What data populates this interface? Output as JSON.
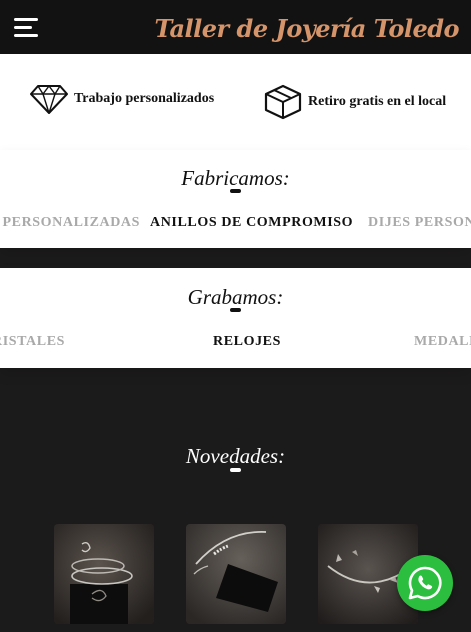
{
  "header": {
    "brand": "Taller de Joyería Toledo",
    "menu_icon": "hamburger-menu-icon"
  },
  "features": [
    {
      "icon": "diamond-icon",
      "label": "Trabajo personalizados"
    },
    {
      "icon": "box-icon",
      "label": "Retiro gratis en el local"
    }
  ],
  "fabricamos": {
    "title": "Fabricamos:",
    "items": [
      "S PERSONALIZADAS",
      "ANILLOS DE COMPROMISO",
      "DIJES PERSONA"
    ]
  },
  "grabamos": {
    "title": "Grabamos:",
    "items": [
      "RISTALES",
      "RELOJES",
      "MEDALL"
    ]
  },
  "novedades": {
    "title": "Novedades:",
    "products": [
      {
        "name": "bracelet-photo-1"
      },
      {
        "name": "bracelet-photo-2"
      },
      {
        "name": "bracelet-photo-3"
      }
    ]
  },
  "whatsapp": {
    "icon": "whatsapp-icon",
    "color": "#2cbf3f"
  },
  "colors": {
    "brand": "#d5946a",
    "header_bg": "#121212",
    "dark_bg": "#1c1b1b"
  }
}
